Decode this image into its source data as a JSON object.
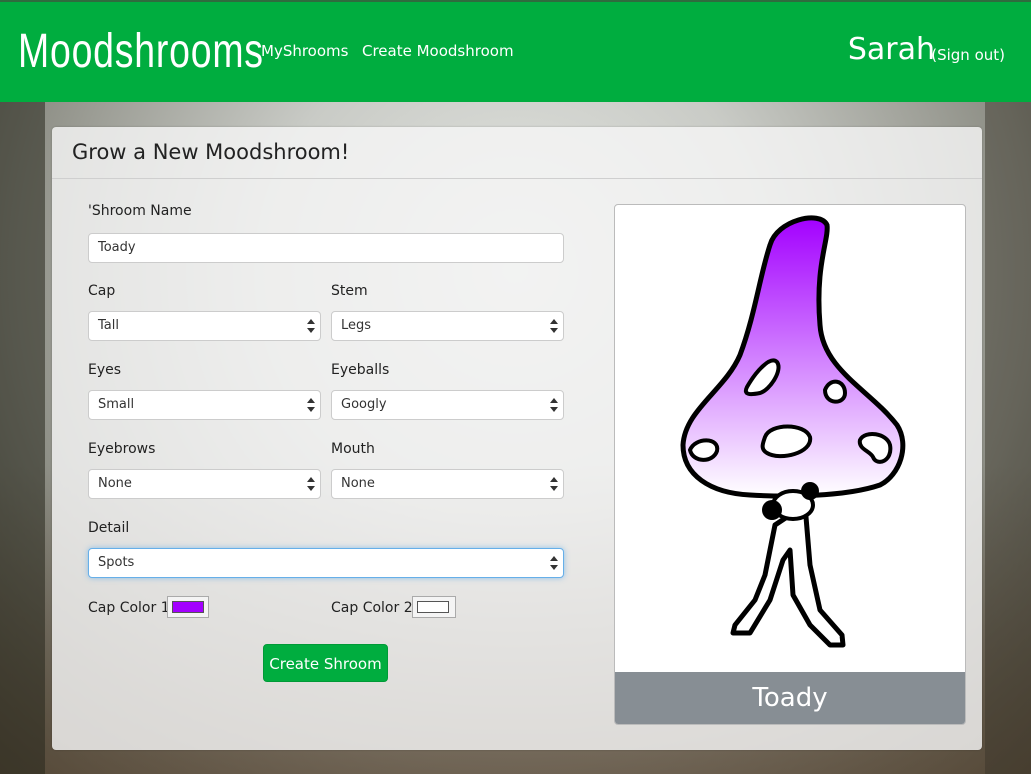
{
  "navbar": {
    "brand": "Moodshrooms",
    "links": [
      "MyShrooms",
      "Create Moodshroom"
    ],
    "user": "Sarah",
    "signout": "(Sign out)"
  },
  "panel": {
    "title": "Grow a New Moodshroom!"
  },
  "form": {
    "name_label": "'Shroom Name",
    "name_value": "Toady",
    "cap_label": "Cap",
    "cap_value": "Tall",
    "stem_label": "Stem",
    "stem_value": "Legs",
    "eyes_label": "Eyes",
    "eyes_value": "Small",
    "eyeballs_label": "Eyeballs",
    "eyeballs_value": "Googly",
    "eyebrows_label": "Eyebrows",
    "eyebrows_value": "None",
    "mouth_label": "Mouth",
    "mouth_value": "None",
    "detail_label": "Detail",
    "detail_value": "Spots",
    "cap_color1_label": "Cap Color 1",
    "cap_color1": "#a300ff",
    "cap_color2_label": "Cap Color 2",
    "cap_color2": "#ffffff",
    "submit_label": "Create Shroom"
  },
  "preview": {
    "name": "Toady"
  },
  "colors": {
    "accent": "#00ad3f",
    "cap_top": "#a300ff",
    "cap_bottom": "#ffffff",
    "footer": "#878e94"
  }
}
